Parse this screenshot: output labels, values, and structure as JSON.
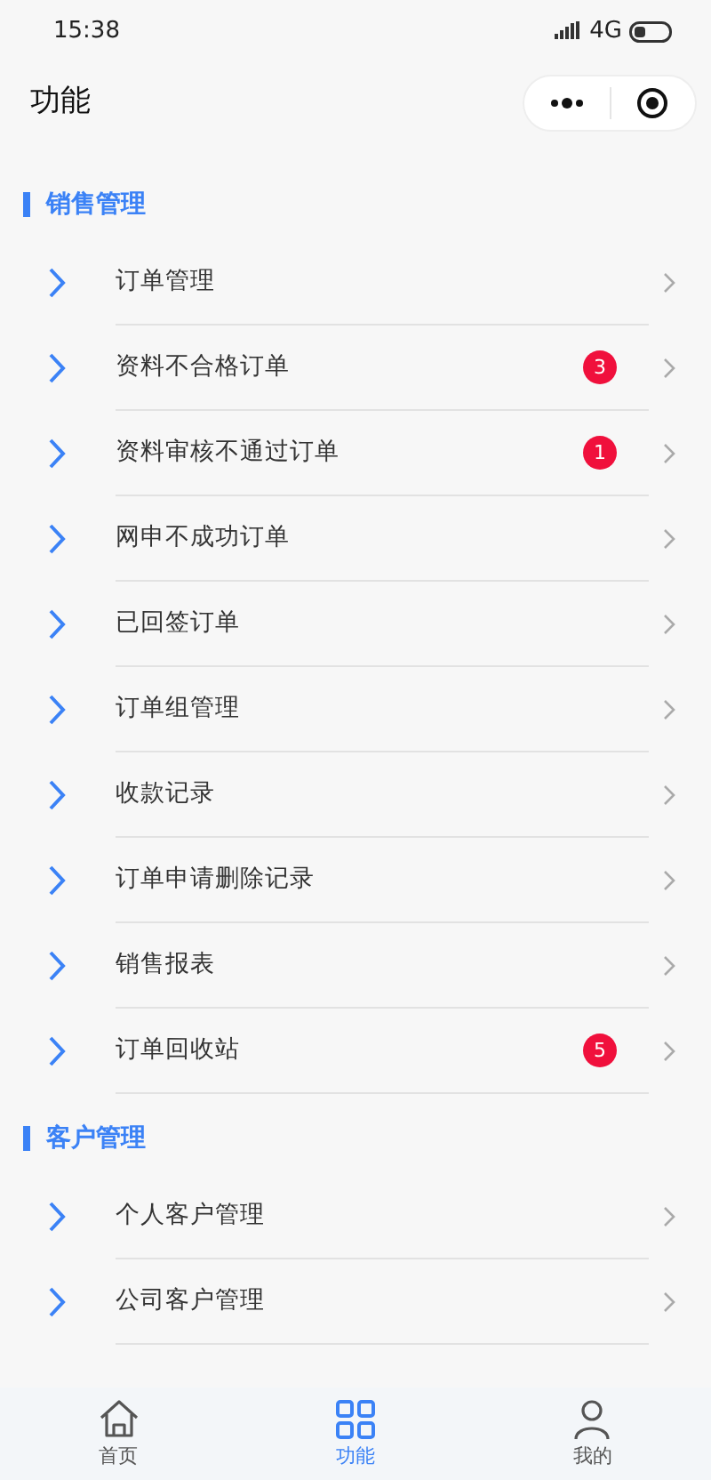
{
  "status_bar": {
    "time": "15:38",
    "network": "4G"
  },
  "header": {
    "title": "功能"
  },
  "sections": [
    {
      "title": "销售管理",
      "items": [
        {
          "label": "订单管理"
        },
        {
          "label": "资料不合格订单",
          "badge": "3"
        },
        {
          "label": "资料审核不通过订单",
          "badge": "1"
        },
        {
          "label": "网申不成功订单"
        },
        {
          "label": "已回签订单"
        },
        {
          "label": "订单组管理"
        },
        {
          "label": "收款记录"
        },
        {
          "label": "订单申请删除记录"
        },
        {
          "label": "销售报表"
        },
        {
          "label": "订单回收站",
          "badge": "5"
        }
      ]
    },
    {
      "title": "客户管理",
      "items": [
        {
          "label": "个人客户管理"
        },
        {
          "label": "公司客户管理"
        }
      ]
    }
  ],
  "tab_bar": [
    {
      "label": "首页",
      "selected": false
    },
    {
      "label": "功能",
      "selected": true
    },
    {
      "label": "我的",
      "selected": false
    }
  ]
}
